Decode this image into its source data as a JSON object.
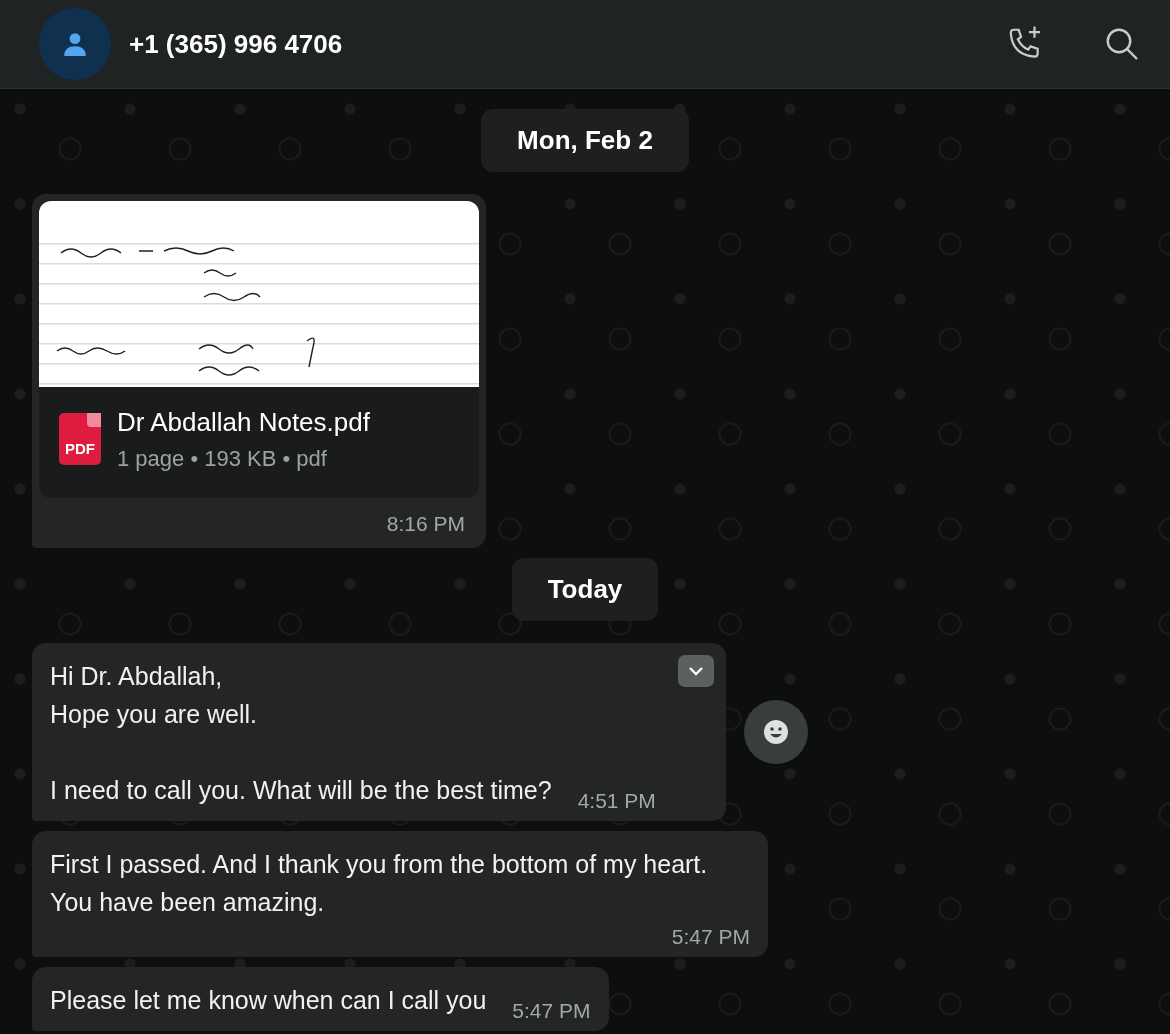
{
  "header": {
    "contact": "+1 (365) 996 4706"
  },
  "messages": [
    {
      "kind": "date",
      "text": "Mon, Feb 2"
    },
    {
      "kind": "document",
      "file_type": "PDF",
      "file_name": "Dr Abdallah Notes.pdf",
      "details": "1 page • 193 KB • pdf",
      "time": "8:16 PM"
    },
    {
      "kind": "date",
      "text": "Today"
    },
    {
      "kind": "text",
      "text": "Hi Dr. Abdallah,\nHope you are well.\n\nI need to call you. What will be the best time?",
      "time": "4:51 PM",
      "hovered": true
    },
    {
      "kind": "text",
      "text": "First I passed. And I thank you from the bottom of my heart. You have been amazing.",
      "time": "5:47 PM",
      "hovered": false
    },
    {
      "kind": "text",
      "text": "Please let me know when can I call you",
      "time": "5:47 PM",
      "hovered": false
    }
  ]
}
